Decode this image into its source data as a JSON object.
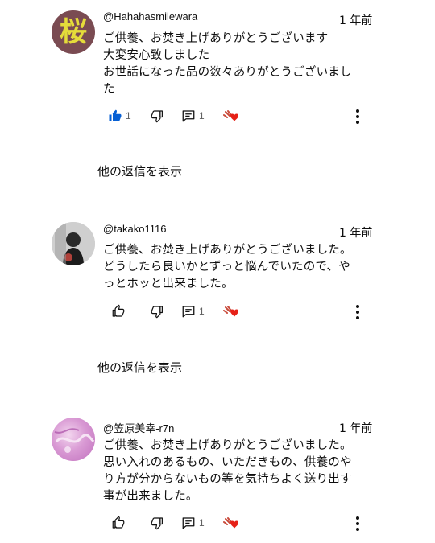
{
  "comments": [
    {
      "author": "@Hahahasmilewara",
      "time": "1 年前",
      "text": "ご供養、お焚き上げありがとうございます\n大変安心致しました\nお世話になった品の数々ありがとうございまし\nた",
      "like_count": "1",
      "reply_count": "1",
      "liked": true,
      "avatar_text": "桜"
    },
    {
      "author": "@takako1116",
      "time": "1 年前",
      "text": "ご供養、お焚き上げありがとうございました。\nどうしたら良いかとずっと悩んでいたので、や\nっとホッと出来ました。",
      "like_count": "",
      "reply_count": "1",
      "liked": false
    },
    {
      "author": "@笠原美幸-r7n",
      "time": "1 年前",
      "text": "ご供養、お焚き上げありがとうございました。\n思い入れのあるもの、いただきもの、供養のや\nり方が分からないもの等を気持ちよく送り出す\n事が出来ました。",
      "like_count": "",
      "reply_count": "1",
      "liked": false
    }
  ],
  "replies_label_1": "他の返信を表示",
  "replies_label_2": "他の返信を表示",
  "colors": {
    "like_active": "#065fd4",
    "heart": "#e62117",
    "text": "#0f0f0f",
    "muted": "#606060"
  }
}
